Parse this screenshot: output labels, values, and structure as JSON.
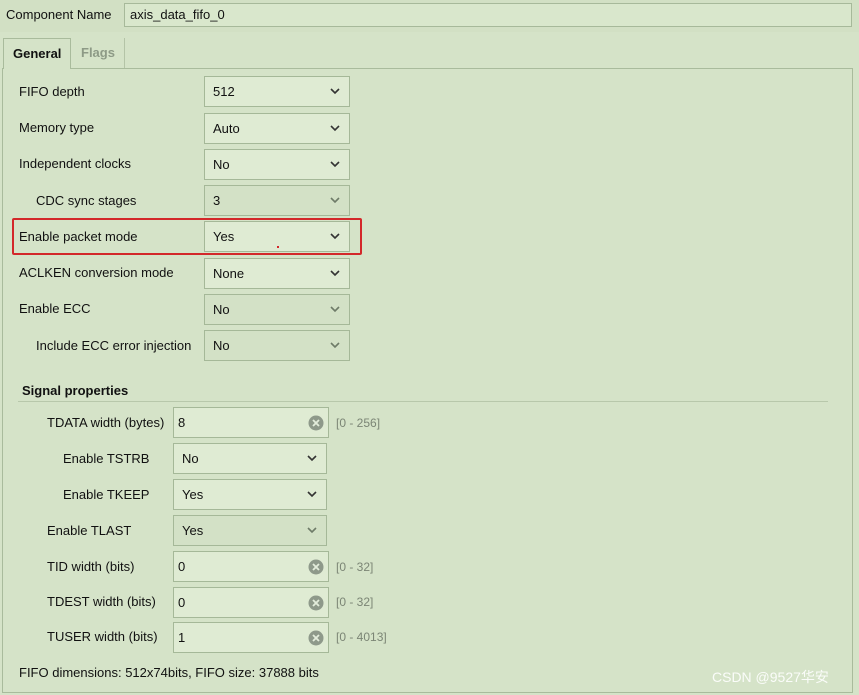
{
  "component": {
    "label": "Component Name",
    "value": "axis_data_fifo_0"
  },
  "tabs": {
    "general": "General",
    "flags": "Flags"
  },
  "general": {
    "fifo_depth": {
      "label": "FIFO depth",
      "value": "512"
    },
    "memory_type": {
      "label": "Memory type",
      "value": "Auto"
    },
    "independent_clocks": {
      "label": "Independent clocks",
      "value": "No"
    },
    "cdc_sync_stages": {
      "label": "CDC sync stages",
      "value": "3"
    },
    "packet_mode": {
      "label": "Enable packet mode",
      "value": "Yes"
    },
    "aclken_mode": {
      "label": "ACLKEN conversion mode",
      "value": "None"
    },
    "enable_ecc": {
      "label": "Enable ECC",
      "value": "No"
    },
    "ecc_injection": {
      "label": "Include ECC error injection",
      "value": "No"
    }
  },
  "signal_properties": {
    "header": "Signal properties",
    "tdata_width": {
      "label": "TDATA width (bytes)",
      "value": "8",
      "range": "[0 - 256]"
    },
    "enable_tstrb": {
      "label": "Enable TSTRB",
      "value": "No"
    },
    "enable_tkeep": {
      "label": "Enable TKEEP",
      "value": "Yes"
    },
    "enable_tlast": {
      "label": "Enable TLAST",
      "value": "Yes"
    },
    "tid_width": {
      "label": "TID width (bits)",
      "value": "0",
      "range": "[0 - 32]"
    },
    "tdest_width": {
      "label": "TDEST width (bits)",
      "value": "0",
      "range": "[0 - 32]"
    },
    "tuser_width": {
      "label": "TUSER width (bits)",
      "value": "1",
      "range": "[0 - 4013]"
    }
  },
  "footer": "FIFO dimensions: 512x74bits, FIFO size: 37888 bits",
  "watermark": "CSDN @9527华安",
  "colors": {
    "highlight": "#d3282a",
    "background": "#d5e3c8"
  }
}
